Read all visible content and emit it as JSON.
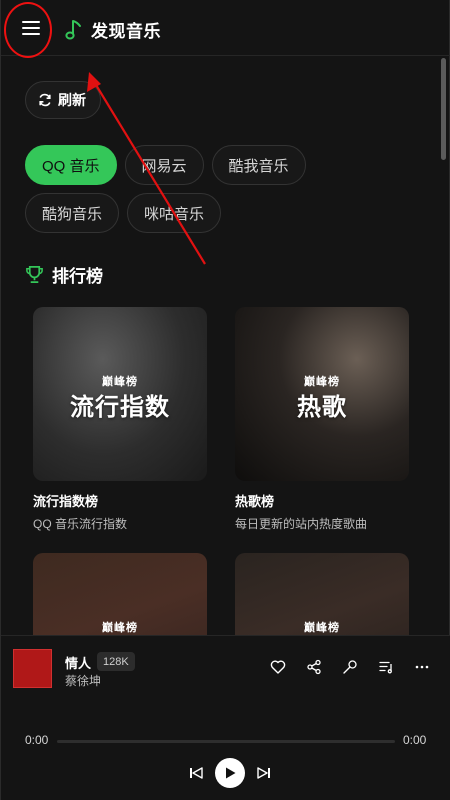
{
  "header": {
    "title": "发现音乐",
    "menu_icon": "hamburger-menu-icon",
    "music_icon": "music-note-icon"
  },
  "refresh": {
    "label": "刷新",
    "icon": "refresh-icon"
  },
  "sources": [
    {
      "label": "QQ 音乐",
      "active": true
    },
    {
      "label": "网易云",
      "active": false
    },
    {
      "label": "酷我音乐",
      "active": false
    },
    {
      "label": "酷狗音乐",
      "active": false
    },
    {
      "label": "咪咕音乐",
      "active": false
    }
  ],
  "section": {
    "title": "排行榜",
    "icon": "trophy-icon"
  },
  "charts": [
    {
      "badge": "巅峰榜",
      "cover_text": "流行指数",
      "name": "流行指数榜",
      "desc": "QQ 音乐流行指数"
    },
    {
      "badge": "巅峰榜",
      "cover_text": "热歌",
      "name": "热歌榜",
      "desc": "每日更新的站内热度歌曲"
    },
    {
      "badge": "巅峰榜",
      "cover_text": "",
      "name": "",
      "desc": ""
    },
    {
      "badge": "巅峰榜",
      "cover_text": "",
      "name": "",
      "desc": ""
    }
  ],
  "player": {
    "song": "情人",
    "quality": "128K",
    "artist": "蔡徐坤",
    "time_current": "0:00",
    "time_total": "0:00",
    "progress": 0
  },
  "colors": {
    "accent": "#34c759",
    "background": "#141414",
    "annotation": "#e11111"
  }
}
